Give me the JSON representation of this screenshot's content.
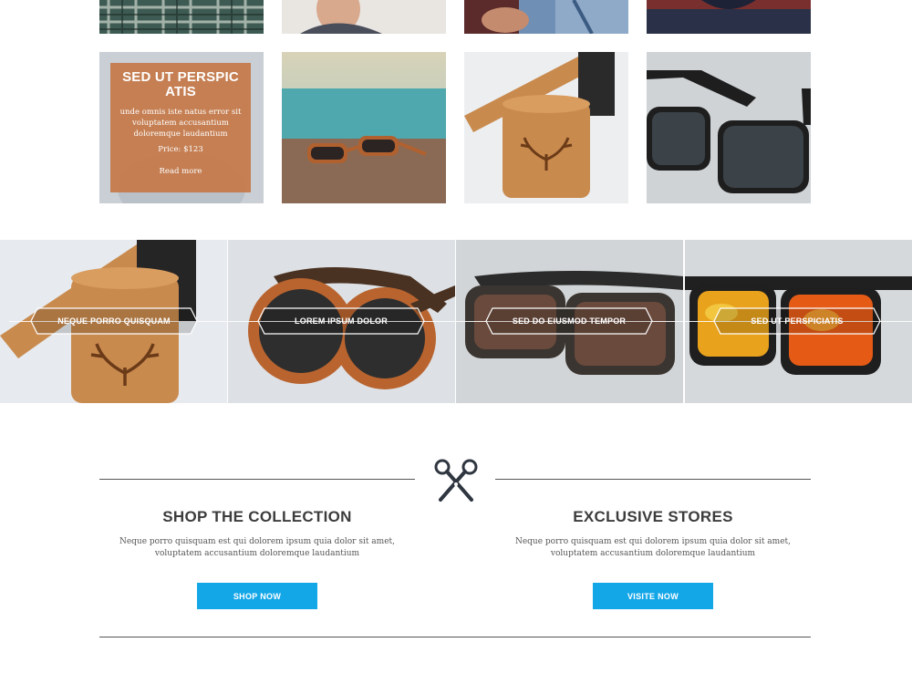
{
  "featured": {
    "title": "SED UT PERSPIC ATIS",
    "description": "unde omnis iste natus error sit voluptatem accusantium doloremque laudantium",
    "price": "Price: $123",
    "read_more": "Read more"
  },
  "strip": {
    "labels": [
      "NEQUE PORRO QUISQUAM",
      "LOREM IPSUM DOLOR",
      "SED DO EIUSMOD TEMPOR",
      "SED UT PERSPICIATIS"
    ]
  },
  "promo": {
    "left": {
      "heading": "SHOP THE COLLECTION",
      "text_line1": "Neque porro quisquam est qui dolorem ipsum quia dolor sit amet,",
      "text_line2": "voluptatem accusantium doloremque laudantium",
      "button": "SHOP NOW"
    },
    "right": {
      "heading": "EXCLUSIVE STORES",
      "text_line1": "Neque porro quisquam est qui dolorem ipsum quia dolor sit amet,",
      "text_line2": "voluptatem accusantium doloremque laudantium",
      "button": "VISITE NOW"
    }
  },
  "icons": {
    "divider": "scissors-icon"
  },
  "colors": {
    "accent": "#14a7e8",
    "overlay": "#c47848",
    "line": "#555555"
  }
}
